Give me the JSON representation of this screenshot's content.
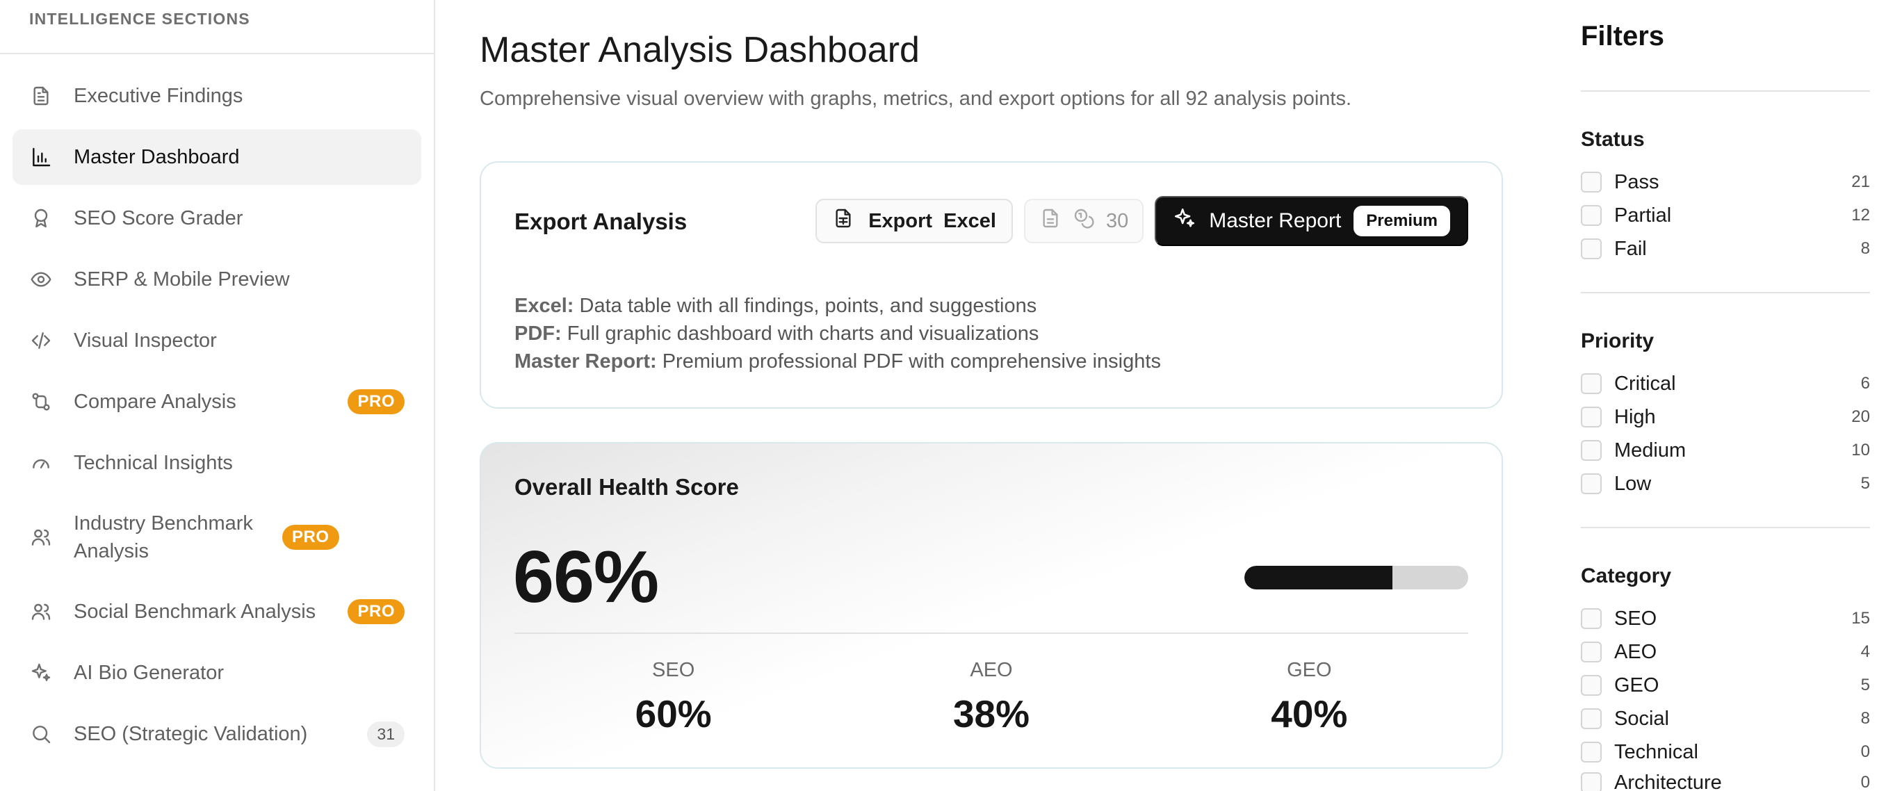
{
  "sidebar": {
    "header": "INTELLIGENCE SECTIONS",
    "items": [
      {
        "label": "Executive Findings",
        "icon": "document-icon"
      },
      {
        "label": "Master Dashboard",
        "icon": "bar-chart-icon",
        "active": true
      },
      {
        "label": "SEO Score Grader",
        "icon": "award-icon"
      },
      {
        "label": "SERP & Mobile Preview",
        "icon": "eye-icon"
      },
      {
        "label": "Visual Inspector",
        "icon": "code-icon"
      },
      {
        "label": "Compare Analysis",
        "icon": "git-compare-icon",
        "badge": "PRO"
      },
      {
        "label": "Technical Insights",
        "icon": "gauge-icon"
      },
      {
        "label": "Industry Benchmark Analysis",
        "icon": "users-icon",
        "badge": "PRO"
      },
      {
        "label": "Social Benchmark Analysis",
        "icon": "users-icon",
        "badge": "PRO"
      },
      {
        "label": "AI Bio Generator",
        "icon": "sparkles-icon"
      },
      {
        "label": "SEO (Strategic Validation)",
        "icon": "search-icon",
        "count": "31"
      }
    ]
  },
  "main": {
    "title": "Master Analysis Dashboard",
    "subtitle": "Comprehensive visual overview with graphs, metrics, and export options for all 92 analysis points.",
    "export": {
      "title": "Export Analysis",
      "excel_label_1": "Export",
      "excel_label_2": "Excel",
      "pdf_count": "30",
      "master_label": "Master Report",
      "premium_label": "Premium",
      "desc": [
        {
          "term": "Excel:",
          "text": " Data table with all findings, points, and suggestions"
        },
        {
          "term": "PDF:",
          "text": " Full graphic dashboard with charts and visualizations"
        },
        {
          "term": "Master Report:",
          "text": " Premium professional PDF with comprehensive insights"
        }
      ]
    },
    "health": {
      "title": "Overall Health Score",
      "value": "66%",
      "progress_fraction": 0.66,
      "metrics": [
        {
          "label": "SEO",
          "value": "60%"
        },
        {
          "label": "AEO",
          "value": "38%"
        },
        {
          "label": "GEO",
          "value": "40%"
        }
      ]
    }
  },
  "filters": {
    "title": "Filters",
    "groups": [
      {
        "title": "Status",
        "options": [
          {
            "label": "Pass",
            "count": "21"
          },
          {
            "label": "Partial",
            "count": "12"
          },
          {
            "label": "Fail",
            "count": "8"
          }
        ]
      },
      {
        "title": "Priority",
        "options": [
          {
            "label": "Critical",
            "count": "6"
          },
          {
            "label": "High",
            "count": "20"
          },
          {
            "label": "Medium",
            "count": "10"
          },
          {
            "label": "Low",
            "count": "5"
          }
        ]
      },
      {
        "title": "Category",
        "options": [
          {
            "label": "SEO",
            "count": "15"
          },
          {
            "label": "AEO",
            "count": "4"
          },
          {
            "label": "GEO",
            "count": "5"
          },
          {
            "label": "Social",
            "count": "8"
          },
          {
            "label": "Technical",
            "count": "0"
          },
          {
            "label": "Architecture",
            "count": "0"
          }
        ]
      }
    ]
  },
  "colors": {
    "accent_dark": "#111111",
    "pro_badge": "#f09a12",
    "card_border": "#d8e9ee"
  }
}
